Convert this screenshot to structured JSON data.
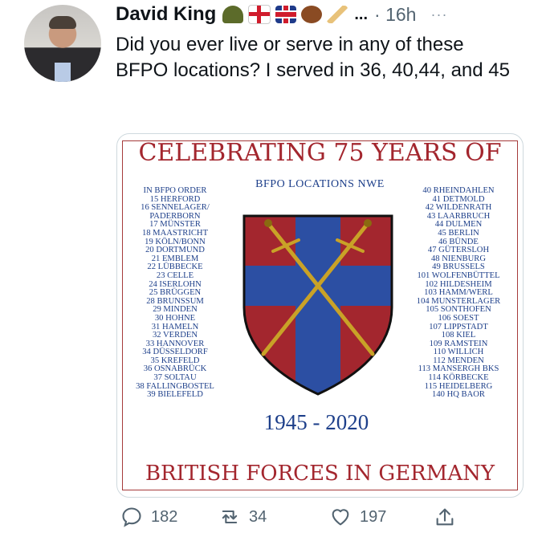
{
  "tweet": {
    "author": "David King",
    "time": "16h",
    "ellipsis": "...",
    "more": "···",
    "text": "Did you ever live or serve in any of these BFPO locations? I served in 36, 40,44, and 45",
    "emoji_icons": [
      "military-helmet-icon",
      "england-flag-icon",
      "uk-flag-icon",
      "rugby-ball-icon",
      "cricket-bat-icon"
    ]
  },
  "poster": {
    "title": "CELEBRATING 75 YEARS OF",
    "subtitle": "BFPO LOCATIONS NWE",
    "years": "1945 - 2020",
    "bottom": "BRITISH FORCES IN GERMANY",
    "left_list": [
      "IN BFPO ORDER",
      "15 HERFORD",
      "16 SENNELAGER/",
      "PADERBORN",
      "17 MÜNSTER",
      "18 MAASTRICHT",
      "19 KÖLN/BONN",
      "20 DORTMUND",
      "21 EMBLEM",
      "22 LÜBBECKE",
      "23 CELLE",
      "24 ISERLOHN",
      "25 BRÜGGEN",
      "28 BRUNSSUM",
      "29 MINDEN",
      "30 HOHNE",
      "31 HAMELN",
      "32 VERDEN",
      "33 HANNOVER",
      "34 DÜSSELDORF",
      "35 KREFELD",
      "36 OSNABRÜCK",
      "37 SOLTAU",
      "38 FALLINGBOSTEL",
      "39 BIELEFELD"
    ],
    "right_list": [
      "40 RHEINDAHLEN",
      "41 DETMOLD",
      "42 WILDENRATH",
      "43 LAARBRUCH",
      "44 DULMEN",
      "45 BERLIN",
      "46 BÜNDE",
      "47 GÜTERSLOH",
      "48 NIENBURG",
      "49 BRUSSELS",
      "101 WOLFENBÜTTEL",
      "102 HILDESHEIM",
      "103 HAMM/WERL",
      "104 MUNSTERLAGER",
      "105 SONTHOFEN",
      "106 SOEST",
      "107 LIPPSTADT",
      "108 KIEL",
      "109 RAMSTEIN",
      "110 WILLICH",
      "112 MENDEN",
      "113 MANSERGH BKS",
      "114 KÖRBECKE",
      "115 HEIDELBERG",
      "140 HQ BAOR"
    ],
    "colors": {
      "red": "#a3262e",
      "blue": "#1d3f8a"
    }
  },
  "actions": {
    "replies": "182",
    "retweets": "34",
    "likes": "197"
  }
}
